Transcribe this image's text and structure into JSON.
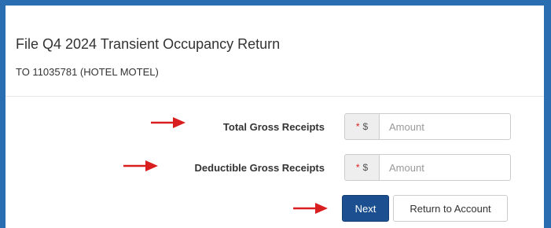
{
  "page": {
    "title": "File Q4 2024 Transient Occupancy Return",
    "account_line": "TO 11035781 (HOTEL MOTEL)"
  },
  "form": {
    "fields": [
      {
        "label": "Total Gross Receipts",
        "required_marker": "*",
        "currency_symbol": "$",
        "placeholder": "Amount",
        "value": ""
      },
      {
        "label": "Deductible Gross Receipts",
        "required_marker": "*",
        "currency_symbol": "$",
        "placeholder": "Amount",
        "value": ""
      }
    ]
  },
  "buttons": {
    "next_label": "Next",
    "return_label": "Return to Account"
  },
  "colors": {
    "frame_border": "#2a6db0",
    "primary_button": "#1b4f8f",
    "required_marker": "#e41b1b",
    "annotation_arrow": "#d81e1e"
  }
}
